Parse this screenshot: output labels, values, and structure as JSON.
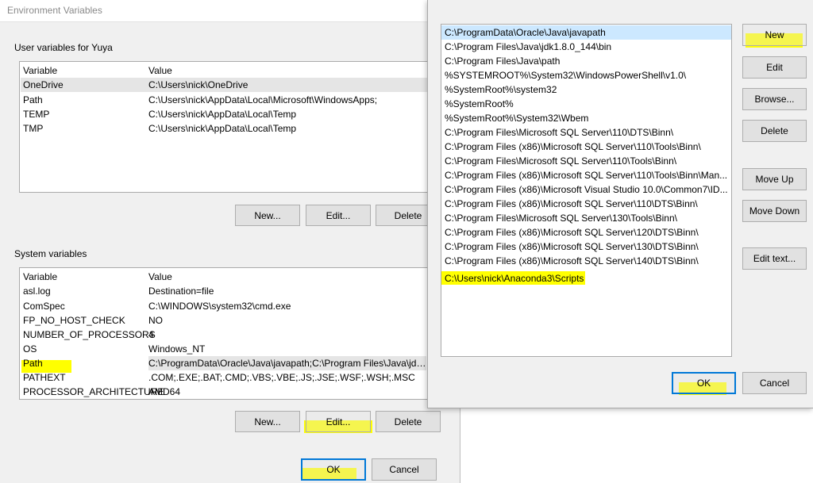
{
  "env_dialog": {
    "title": "Environment Variables",
    "user_group_label": "User variables for Yuya",
    "user_columns": [
      "Variable",
      "Value"
    ],
    "user_vars": [
      {
        "name": "OneDrive",
        "value": "C:\\Users\\nick\\OneDrive"
      },
      {
        "name": "Path",
        "value": "C:\\Users\\nick\\AppData\\Local\\Microsoft\\WindowsApps;"
      },
      {
        "name": "TEMP",
        "value": "C:\\Users\\nick\\AppData\\Local\\Temp"
      },
      {
        "name": "TMP",
        "value": "C:\\Users\\nick\\AppData\\Local\\Temp"
      }
    ],
    "user_buttons": {
      "new": "New...",
      "edit": "Edit...",
      "delete": "Delete"
    },
    "system_group_label": "System variables",
    "system_columns": [
      "Variable",
      "Value"
    ],
    "system_vars": [
      {
        "name": "asl.log",
        "value": "Destination=file"
      },
      {
        "name": "ComSpec",
        "value": "C:\\WINDOWS\\system32\\cmd.exe"
      },
      {
        "name": "FP_NO_HOST_CHECK",
        "value": "NO"
      },
      {
        "name": "NUMBER_OF_PROCESSORS",
        "value": "4"
      },
      {
        "name": "OS",
        "value": "Windows_NT"
      },
      {
        "name": "Path",
        "value": "C:\\ProgramData\\Oracle\\Java\\javapath;C:\\Program Files\\Java\\jdk..."
      },
      {
        "name": "PATHEXT",
        "value": ".COM;.EXE;.BAT;.CMD;.VBS;.VBE;.JS;.JSE;.WSF;.WSH;.MSC"
      },
      {
        "name": "PROCESSOR_ARCHITECTURE",
        "value": "AMD64"
      }
    ],
    "system_buttons": {
      "new": "New...",
      "edit": "Edit...",
      "delete": "Delete"
    },
    "ok": "OK",
    "cancel": "Cancel"
  },
  "edit_dialog": {
    "paths": [
      "C:\\ProgramData\\Oracle\\Java\\javapath",
      "C:\\Program Files\\Java\\jdk1.8.0_144\\bin",
      "C:\\Program Files\\Java\\path",
      "%SYSTEMROOT%\\System32\\WindowsPowerShell\\v1.0\\",
      "%SystemRoot%\\system32",
      "%SystemRoot%",
      "%SystemRoot%\\System32\\Wbem",
      "C:\\Program Files\\Microsoft SQL Server\\110\\DTS\\Binn\\",
      "C:\\Program Files (x86)\\Microsoft SQL Server\\110\\Tools\\Binn\\",
      "C:\\Program Files\\Microsoft SQL Server\\110\\Tools\\Binn\\",
      "C:\\Program Files (x86)\\Microsoft SQL Server\\110\\Tools\\Binn\\Man...",
      "C:\\Program Files (x86)\\Microsoft Visual Studio 10.0\\Common7\\ID...",
      "C:\\Program Files (x86)\\Microsoft SQL Server\\110\\DTS\\Binn\\",
      "C:\\Program Files\\Microsoft SQL Server\\130\\Tools\\Binn\\",
      "C:\\Program Files (x86)\\Microsoft SQL Server\\120\\DTS\\Binn\\",
      "C:\\Program Files (x86)\\Microsoft SQL Server\\130\\DTS\\Binn\\",
      "C:\\Program Files (x86)\\Microsoft SQL Server\\140\\DTS\\Binn\\",
      "C:\\Users\\nick\\Anaconda3\\Scripts"
    ],
    "buttons": {
      "new": "New",
      "edit": "Edit",
      "browse": "Browse...",
      "delete": "Delete",
      "move_up": "Move Up",
      "move_down": "Move Down",
      "edit_text": "Edit text..."
    },
    "ok": "OK",
    "cancel": "Cancel"
  },
  "colors": {
    "highlight": "#ffff00",
    "selection": "#e5e5e5",
    "list_selection": "#cce8ff",
    "dialog_bg": "#f0f0f0",
    "default_button_border": "#0078d7"
  }
}
